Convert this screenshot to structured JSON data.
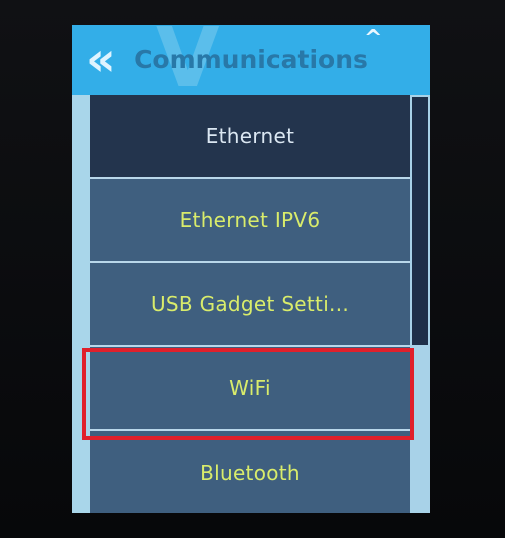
{
  "window": {
    "title": "Communications"
  },
  "header": {
    "back_icon": "double-chevron-left-icon",
    "up_icon": "chevron-up-icon",
    "watermark": "V"
  },
  "menu": {
    "items": [
      {
        "label": "Ethernet",
        "state": "selected"
      },
      {
        "label": "Ethernet IPV6",
        "state": "normal"
      },
      {
        "label": "USB Gadget Setti...",
        "state": "normal"
      },
      {
        "label": "WiFi",
        "state": "normal",
        "highlighted": true
      },
      {
        "label": "Bluetooth",
        "state": "normal"
      }
    ]
  },
  "colors": {
    "header": "#33aee8",
    "selected_item": "#23344d",
    "normal_item": "#3f5f7f",
    "normal_text": "#d9ec6b",
    "selected_text": "#dbe7f2",
    "highlight_outline": "#e0202b"
  }
}
